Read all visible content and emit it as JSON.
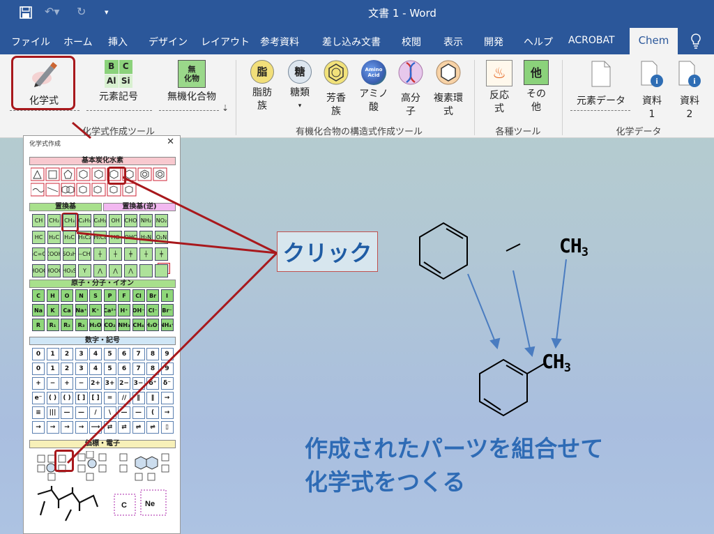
{
  "titlebar": {
    "doc_title": "文書 1  -  Word",
    "color": "#2b579a"
  },
  "tabs": [
    "ファイル",
    "ホーム",
    "挿入",
    "デザイン",
    "レイアウト",
    "参考資料",
    "差し込み文書",
    "校閲",
    "表示",
    "開発",
    "ヘルプ",
    "ACROBAT"
  ],
  "active_tab": "Chem",
  "ribbon": {
    "chem_formula": "化学式",
    "element_symbol": "元素記号",
    "inorganic": "無機化合物",
    "elem_icon": [
      "B",
      "C",
      "Al",
      "Si"
    ],
    "inorganic_icon": "無\n化物",
    "lipid": [
      "脂肪",
      "族"
    ],
    "lipid_icon": "脂",
    "sugar": "糖類",
    "sugar_icon": "糖",
    "aromatic": [
      "芳香",
      "族"
    ],
    "amino": [
      "アミノ",
      "酸"
    ],
    "amino_icon": "Amino\nAcid",
    "polymer": [
      "高分",
      "子"
    ],
    "hetero": [
      "複素環",
      "式"
    ],
    "reaction": [
      "反応",
      "式"
    ],
    "other": [
      "その",
      "他"
    ],
    "other_icon": "他",
    "element_data": "元素データ",
    "doc1": [
      "資料",
      "1"
    ],
    "doc2": [
      "資料",
      "2"
    ],
    "group_chem": "化学式作成ツール",
    "group_organic": "有機化合物の構造式作成ツール",
    "group_tools": "各種ツール",
    "group_data": "化学データ"
  },
  "panel": {
    "title": "化学式作成",
    "close": "✕",
    "sec_hydrocarbon": "基本炭化水素",
    "sec_subst": "置換基",
    "sec_subst_rev": "置換基(逆)",
    "sec_atoms": "原子・分子・イオン",
    "sec_numbers": "数字・記号",
    "sec_bonds": "価標・電子",
    "subst_row1": [
      "CH",
      "CH₂",
      "CH₃",
      "C₂H₅",
      "C₆H₅",
      "OH",
      "CHO",
      "NH₂",
      "NO₂"
    ],
    "subst_row2": [
      "HC",
      "H₂C",
      "H₃C",
      "H₅C₂",
      "H₅C₆",
      "HO",
      "OHC",
      "H₂N",
      "O₂N"
    ],
    "subst_row3": [
      "H₂C=CH",
      "COOH",
      "SO₃H",
      "—CH₂",
      "┼",
      "┼",
      "╪",
      "┼",
      "╪"
    ],
    "subst_row4": [
      "HOOC",
      "HOOC",
      "HO₃S",
      "Y",
      "⋀",
      "⋀",
      "⋀",
      "",
      ""
    ],
    "kanji_btn": "基",
    "atom_row1": [
      "C",
      "H",
      "O",
      "N",
      "S",
      "P",
      "F",
      "Cl",
      "Br",
      "I"
    ],
    "atom_row2": [
      "Na",
      "K",
      "Ca",
      "Na⁺",
      "K⁺",
      "Ca²⁺",
      "H⁺",
      "OH⁻",
      "Cl⁻",
      "Br⁻"
    ],
    "atom_row3": [
      "R",
      "R₁",
      "R₂",
      "R₃",
      "H₂O",
      "CO₂",
      "NH₃",
      "CH₄",
      "H₃O⁺",
      "NH₄⁺"
    ],
    "num_row1": [
      "0",
      "1",
      "2",
      "3",
      "4",
      "5",
      "6",
      "7",
      "8",
      "9"
    ],
    "num_row2": [
      "0",
      "1",
      "2",
      "3",
      "4",
      "5",
      "6",
      "7",
      "8",
      "9"
    ],
    "num_row3": [
      "+",
      "−",
      "+",
      "−",
      "2+",
      "3+",
      "2−",
      "3−",
      "δ⁺",
      "δ⁻"
    ],
    "num_row4": [
      "e⁻",
      "( )",
      "( )",
      "[ ]",
      "[ ]",
      "=",
      "//",
      "∥",
      "∥",
      "→"
    ],
    "num_row5": [
      "≡",
      "|||",
      "—",
      "—",
      "/",
      "\\",
      "—",
      "—",
      "(",
      "→"
    ],
    "num_row6": [
      "→",
      "→",
      "→",
      "→",
      "⟶",
      "⇄",
      "⇄",
      "⇌",
      "⇌",
      "▯"
    ],
    "lewis_c": "C",
    "lewis_ne": "Ne"
  },
  "annotation": {
    "click": "クリック"
  },
  "molecule": {
    "ch3_top": [
      "CH",
      "3"
    ],
    "ch3_bottom": [
      "CH",
      "3"
    ]
  },
  "caption": [
    "作成されたパーツを組合せて",
    "化学式をつくる"
  ],
  "colors": {
    "accent_red": "#a8181c",
    "caption_blue": "#2e6bb5",
    "arrow_blue": "#4a7cc0"
  }
}
